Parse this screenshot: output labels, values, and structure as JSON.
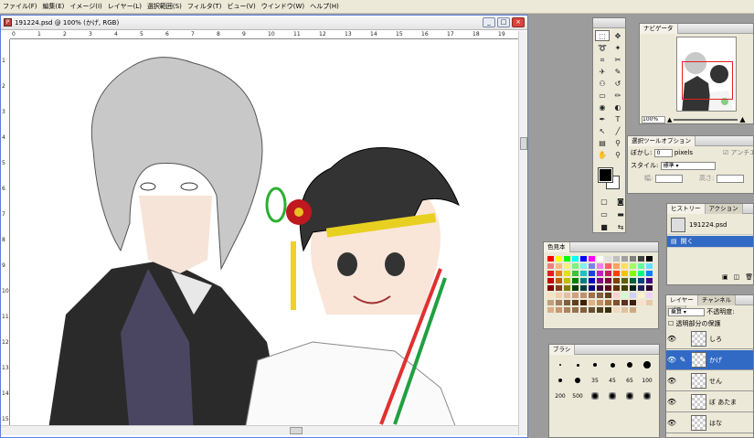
{
  "menu": [
    "ファイル(F)",
    "編集(E)",
    "イメージ(I)",
    "レイヤー(L)",
    "選択範囲(S)",
    "フィルタ(T)",
    "ビュー(V)",
    "ウインドウ(W)",
    "ヘルプ(H)"
  ],
  "document": {
    "title": "191224.psd @ 100% (かげ, RGB)",
    "minimize": "_",
    "restore": "□",
    "close": "×"
  },
  "rulers": {
    "h": [
      "0",
      "1",
      "2",
      "3",
      "4",
      "5",
      "6",
      "7",
      "8",
      "9",
      "10",
      "11",
      "12",
      "13",
      "14",
      "15",
      "16",
      "17",
      "18",
      "19"
    ],
    "v": [
      "1",
      "2",
      "3",
      "4",
      "5",
      "6",
      "7",
      "8",
      "9",
      "10",
      "11",
      "12",
      "13",
      "14",
      "15"
    ]
  },
  "navigator": {
    "tab": "ナビゲータ",
    "zoom": "100%"
  },
  "options": {
    "tab": "選択ツールオプション",
    "feather_label": "ぼかし:",
    "feather_value": "0",
    "feather_unit": "pixels",
    "antialias": "☑ アンチエ",
    "style_label": "スタイル:",
    "style_value": "標準",
    "width_label": "幅:",
    "height_label": "高さ:"
  },
  "history": {
    "tabs": [
      "ヒストリー",
      "アクション"
    ],
    "items": [
      {
        "label": "191224.psd"
      },
      {
        "label": "開く"
      }
    ]
  },
  "colors": {
    "tab": "色見本",
    "swatches": [
      "#ff0000",
      "#ffff00",
      "#00ff00",
      "#00ffff",
      "#0000ff",
      "#ff00ff",
      "#ffffff",
      "#e0e0e0",
      "#c0c0c0",
      "#a0a0a0",
      "#808080",
      "#404040",
      "#000000",
      "#f08080",
      "#f0c080",
      "#f0f080",
      "#80f080",
      "#80f0f0",
      "#8080f0",
      "#f080f0",
      "#ff6060",
      "#ffa060",
      "#ffe060",
      "#a0ff60",
      "#60ffa0",
      "#60e0ff",
      "#e02020",
      "#e08020",
      "#e0e020",
      "#40c040",
      "#20c0c0",
      "#2040e0",
      "#c020c0",
      "#c02060",
      "#ff4000",
      "#ffc000",
      "#80ff00",
      "#00ff80",
      "#0080ff",
      "#c00000",
      "#c06000",
      "#c0c000",
      "#008000",
      "#008080",
      "#0000c0",
      "#800080",
      "#800040",
      "#804000",
      "#606000",
      "#006040",
      "#004080",
      "#400080",
      "#800000",
      "#804020",
      "#808000",
      "#004000",
      "#004040",
      "#000080",
      "#400040",
      "#600020",
      "#603000",
      "#404000",
      "#002020",
      "#202060",
      "#300030",
      "#ffe0c0",
      "#f0d0b0",
      "#e0c0a0",
      "#d0a080",
      "#c09070",
      "#a07050",
      "#806040",
      "#604020",
      "#ffd0d0",
      "#d0ffd0",
      "#d0d0ff",
      "#fff0d0",
      "#f0d0ff",
      "#c0a080",
      "#a08060",
      "#806040",
      "#604020",
      "#402000",
      "#e0b080",
      "#c09060",
      "#a07040",
      "#805030",
      "#603020",
      "#402010",
      "#f8e0c8",
      "#e8c8a8",
      "#d8b088",
      "#c89870",
      "#b08060",
      "#987050",
      "#806040",
      "#685030",
      "#504020",
      "#383010",
      "#f0d8c0",
      "#e0c0a0",
      "#d0a880"
    ]
  },
  "brushes": {
    "tab": "ブラシ",
    "sizes": [
      "",
      "",
      "",
      "",
      "",
      "",
      "",
      "",
      "35",
      "45",
      "65",
      "100",
      "200",
      "500",
      "",
      "",
      "",
      ""
    ]
  },
  "layers": {
    "tabs": [
      "レイヤー",
      "チャンネル",
      "パス"
    ],
    "mode": "乗算",
    "opacity_label": "不透明度:",
    "preserve": "透明部分の保護",
    "items": [
      {
        "name": "しろ"
      },
      {
        "name": "かげ"
      },
      {
        "name": "せん"
      },
      {
        "name": "ぼ あたま"
      },
      {
        "name": "はな"
      }
    ]
  }
}
